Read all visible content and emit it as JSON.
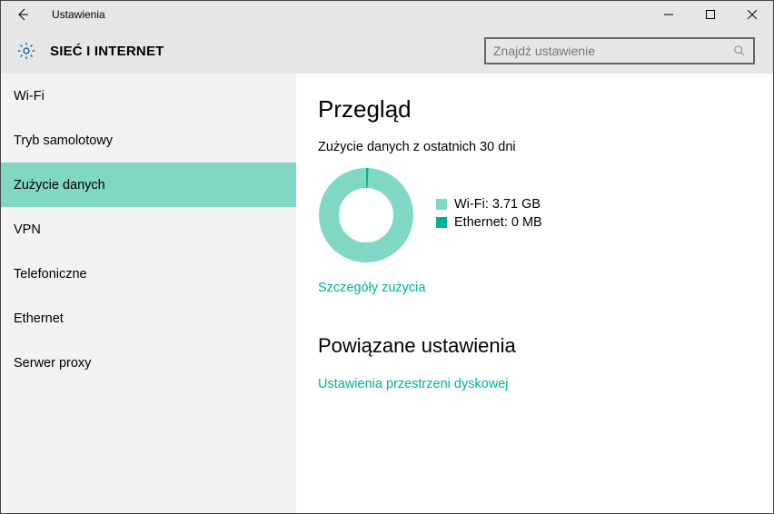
{
  "window": {
    "title": "Ustawienia"
  },
  "header": {
    "section_title": "SIEĆ I INTERNET",
    "search_placeholder": "Znajdź ustawienie"
  },
  "sidebar": {
    "items": [
      {
        "label": "Wi-Fi",
        "selected": false
      },
      {
        "label": "Tryb samolotowy",
        "selected": false
      },
      {
        "label": "Zużycie danych",
        "selected": true
      },
      {
        "label": "VPN",
        "selected": false
      },
      {
        "label": "Telefoniczne",
        "selected": false
      },
      {
        "label": "Ethernet",
        "selected": false
      },
      {
        "label": "Serwer proxy",
        "selected": false
      }
    ]
  },
  "main": {
    "overview_heading": "Przegląd",
    "subheading": "Zużycie danych z ostatnich 30 dni",
    "legend": {
      "wifi_label": "Wi-Fi: 3.71 GB",
      "ethernet_label": "Ethernet: 0 MB"
    },
    "details_link": "Szczegóły zużycia",
    "related_heading": "Powiązane ustawienia",
    "storage_link": "Ustawienia przestrzeni dyskowej"
  },
  "chart_data": {
    "type": "pie",
    "title": "Zużycie danych z ostatnich 30 dni",
    "series": [
      {
        "name": "Wi-Fi",
        "value_gb": 3.71,
        "color": "#7fd7c4"
      },
      {
        "name": "Ethernet",
        "value_gb": 0,
        "color": "#00b294"
      }
    ]
  }
}
